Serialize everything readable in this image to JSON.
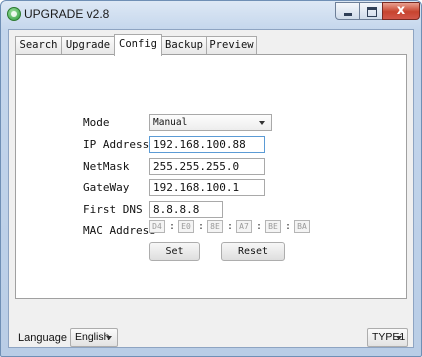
{
  "window": {
    "title": "UPGRADE v2.8",
    "close_glyph": "x"
  },
  "tabs": [
    {
      "label": "Search"
    },
    {
      "label": "Upgrade"
    },
    {
      "label": "Config"
    },
    {
      "label": "Backup"
    },
    {
      "label": "Preview"
    }
  ],
  "config": {
    "mode_label": "Mode",
    "mode_value": "Manual",
    "ip_label": "IP Address",
    "ip_value": "192.168.100.88",
    "netmask_label": "NetMask",
    "netmask_value": "255.255.255.0",
    "gateway_label": "GateWay",
    "gateway_value": "192.168.100.1",
    "dns_label": "First DNS",
    "dns_value": "8.8.8.8",
    "mac_label": "MAC Address",
    "mac_parts": [
      "D4",
      "E0",
      "8E",
      "A7",
      "BE",
      "BA"
    ],
    "mac_separator": ":",
    "set_label": "Set",
    "reset_label": "Reset"
  },
  "footer": {
    "language_label": "Language",
    "language_value": "English",
    "type_value": "TYPE1"
  }
}
